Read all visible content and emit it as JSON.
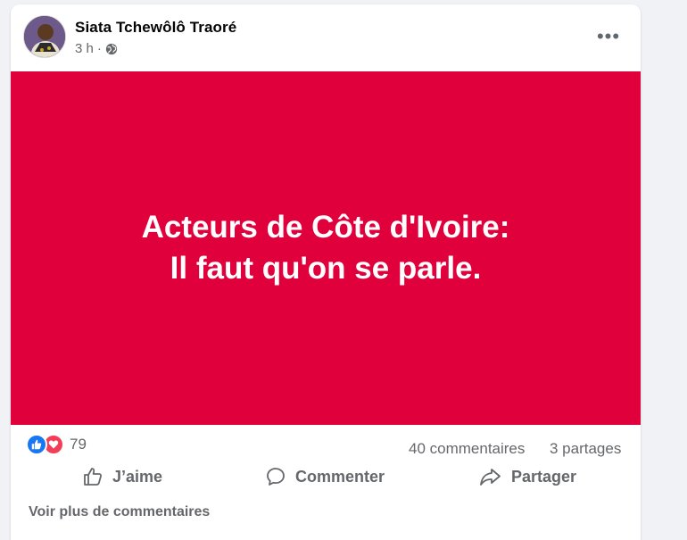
{
  "post": {
    "author": "Siata Tchewôlô Traoré",
    "time": "3 h",
    "separator": "·",
    "privacy_icon": "globe-icon",
    "more_icon": "more-horizontal-icon",
    "more_label": "•••"
  },
  "banner": {
    "line1": "Acteurs de Côte d'Ivoire:",
    "line2": "Il faut qu'on se parle.",
    "background": "#e0003c",
    "text_color": "#ffffff"
  },
  "stats": {
    "reaction_icons": [
      "like-icon",
      "love-icon"
    ],
    "reaction_count": "79",
    "comments": "40 commentaires",
    "shares": "3 partages"
  },
  "actions": {
    "like": "J’aime",
    "comment": "Commenter",
    "share": "Partager"
  },
  "footer": {
    "more_comments": "Voir plus de commentaires"
  },
  "colors": {
    "secondary_text": "#65676b",
    "like_blue": "#1877f2",
    "love_red": "#f33e58"
  }
}
